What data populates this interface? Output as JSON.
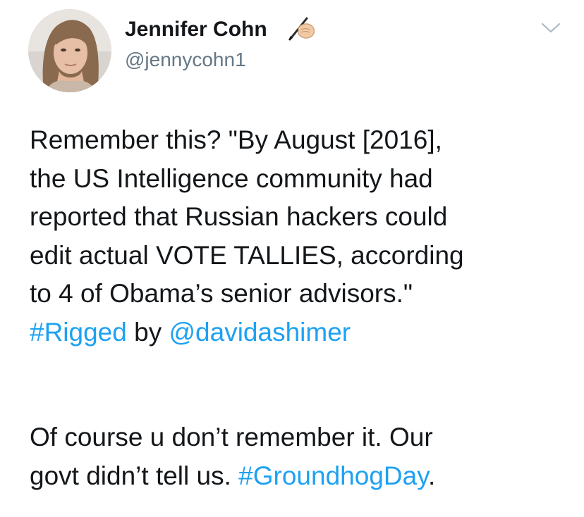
{
  "author": {
    "display_name": "Jennifer Cohn",
    "handle": "@jennycohn1",
    "badge_icon": "writing-hand-icon"
  },
  "menu": {
    "caret_icon": "chevron-down-icon"
  },
  "tweet": {
    "paragraph1": {
      "line1": "Remember this? \"By August [2016],",
      "line2": "the US Intelligence community had",
      "line3": "reported that Russian hackers could",
      "line4": "edit actual VOTE TALLIES, according",
      "line5": "to 4 of Obama’s senior advisors.\"",
      "line6_hashtag": "#Rigged",
      "line6_by": " by ",
      "line6_mention": "@davidashimer"
    },
    "paragraph2": {
      "line1": "Of course u don’t remember it. Our",
      "line2_text": "govt didn’t tell us. ",
      "line2_hashtag": "#GroundhogDay",
      "line2_end": "."
    }
  },
  "colors": {
    "link": "#1da1f2",
    "text": "#14171a",
    "secondary": "#657786"
  }
}
